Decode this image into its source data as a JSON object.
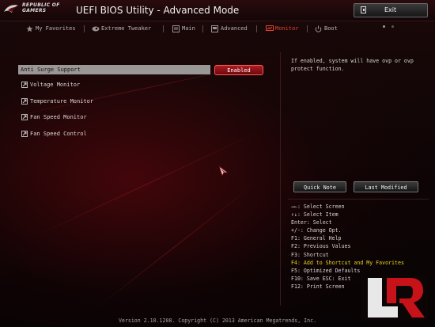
{
  "brand": {
    "line1": "REPUBLIC OF",
    "line2": "GAMERS"
  },
  "title": "UEFI BIOS Utility - Advanced Mode",
  "exit_label": "Exit",
  "tabs": [
    {
      "label": "My Favorites",
      "icon": "star-icon"
    },
    {
      "label": "Extreme Tweaker",
      "icon": "tweaker-icon"
    },
    {
      "label": "Main",
      "icon": "main-icon"
    },
    {
      "label": "Advanced",
      "icon": "advanced-icon"
    },
    {
      "label": "Monitor",
      "icon": "monitor-icon",
      "active": true
    },
    {
      "label": "Boot",
      "icon": "power-icon"
    }
  ],
  "items": [
    {
      "label": "Anti Surge Support",
      "value": "Enabled",
      "selected": true
    },
    {
      "label": "Voltage Monitor",
      "submenu": true
    },
    {
      "label": "Temperature Monitor",
      "submenu": true
    },
    {
      "label": "Fan Speed Monitor",
      "submenu": true
    },
    {
      "label": "Fan Speed Control",
      "submenu": false
    }
  ],
  "help_text": "If enabled, system will have ovp or ovp protect function.",
  "buttons": {
    "quick_note": "Quick Note",
    "last_modified": "Last Modified"
  },
  "keys": [
    "→←: Select Screen",
    "↑↓: Select Item",
    "Enter: Select",
    "+/-: Change Opt.",
    "F1: General Help",
    "F2: Previous Values",
    "F3: Shortcut",
    "F4: Add to Shortcut and My Favorites",
    "F5: Optimized Defaults",
    "F10: Save  ESC: Exit",
    "F12: Print Screen"
  ],
  "footer": "Version 2.10.1208. Copyright (C) 2013 American Megatrends, Inc.",
  "colors": {
    "accent": "#e8402f",
    "highlight_key": "#e8d41c",
    "selected_row": "#9b9797",
    "enabled_button": "#b01a1f"
  }
}
